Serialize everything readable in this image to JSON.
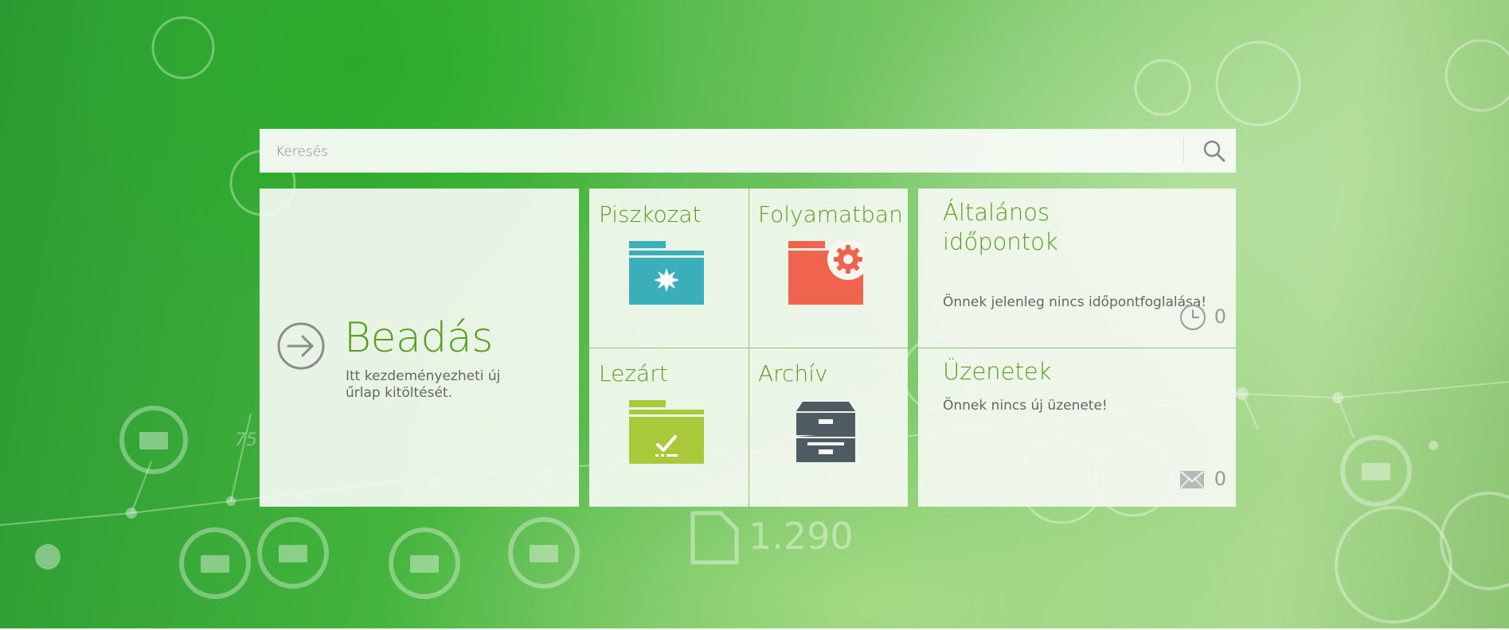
{
  "search": {
    "placeholder": "Keresés",
    "icon": "search-icon"
  },
  "submit_tile": {
    "title": "Beadás",
    "description": "Itt kezdeményezheti új űrlap kitöltését.",
    "icon": "arrow-right-circle-icon"
  },
  "folders": [
    {
      "label": "Piszkozat",
      "icon": "draft-folder-icon",
      "color": "#3aafbb"
    },
    {
      "label": "Folyamatban",
      "icon": "in-progress-folder-icon",
      "color": "#f0644f"
    },
    {
      "label": "Lezárt",
      "icon": "closed-folder-icon",
      "color": "#a9c93b"
    },
    {
      "label": "Archív",
      "icon": "archive-cabinet-icon",
      "color": "#4f5b63"
    }
  ],
  "appointments": {
    "title_line1": "Általános",
    "title_line2": "időpontok",
    "text": "Önnek jelenleg nincs időpontfoglalása!",
    "count": "0",
    "icon": "clock-icon"
  },
  "messages": {
    "title": "Üzenetek",
    "text": "Önnek nincs új üzenete!",
    "count": "0",
    "icon": "envelope-icon"
  },
  "background": {
    "counter_text": "1.290",
    "axis_text": "75"
  },
  "colors": {
    "accent_green": "#5a9e1e",
    "divider_green": "#8ac56a"
  }
}
